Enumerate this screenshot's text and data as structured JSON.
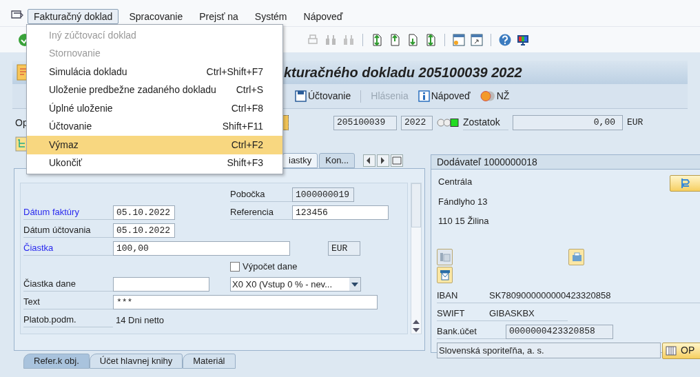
{
  "menu_bar": {
    "items": [
      {
        "label": "Fakturačný doklad",
        "selected": true
      },
      {
        "label": "Spracovanie",
        "selected": false
      },
      {
        "label": "Prejsť na",
        "selected": false
      },
      {
        "label": "Systém",
        "selected": false
      },
      {
        "label": "Nápoveď",
        "selected": false
      }
    ]
  },
  "dropdown_menu": {
    "items": [
      {
        "label": "Iný zúčtovací doklad",
        "disabled": true,
        "selected": false
      },
      {
        "label": "Stornovanie",
        "disabled": true,
        "selected": false
      },
      {
        "label": "Simulácia dokladu",
        "shortcut": "Ctrl+Shift+F7",
        "disabled": false,
        "selected": false
      },
      {
        "label": "Uloženie predbežne zadaného dokladu",
        "shortcut": "Ctrl+S",
        "disabled": false,
        "selected": false
      },
      {
        "label": "Úplné uloženie",
        "shortcut": "Ctrl+F8",
        "disabled": false,
        "selected": false
      },
      {
        "label": "Účtovanie",
        "shortcut": "Shift+F11",
        "disabled": false,
        "selected": false
      },
      {
        "label": "Výmaz",
        "shortcut": "Ctrl+F2",
        "disabled": false,
        "selected": true
      },
      {
        "label": "Ukončiť",
        "shortcut": "Shift+F3",
        "disabled": false,
        "selected": false
      }
    ]
  },
  "title": "kturačného dokladu 205100039 2022",
  "app_toolbar": [
    {
      "kind": "save",
      "label": "Účtovanie",
      "disabled": false
    },
    {
      "kind": "plain",
      "label": "Hlásenia",
      "disabled": true
    },
    {
      "kind": "info",
      "label": "Nápoveď",
      "disabled": false
    },
    {
      "kind": "coins",
      "label": "NŽ",
      "disabled": false
    }
  ],
  "header_row": {
    "label": "Op",
    "document_number": "205100039",
    "year": "2022",
    "balance_label": "Zostatok",
    "balance": "0,00",
    "currency": "EUR"
  },
  "tabs": [
    {
      "label": "iastky",
      "selected": true
    },
    {
      "label": "Kon...",
      "selected": false
    }
  ],
  "form": {
    "branch_label": "Pobočka",
    "branch": "1000000019",
    "invoice_date_label": "Dátum faktúry",
    "invoice_date": "05.10.2022",
    "invoice_date_required": true,
    "reference_label": "Referencia",
    "reference": "123456",
    "posting_date_label": "Dátum účtovania",
    "posting_date": "05.10.2022",
    "posting_date_required": false,
    "amount_label": "Čiastka",
    "amount": "100,00",
    "amount_required": true,
    "currency": "EUR",
    "tax_calc_label": "Výpočet dane",
    "tax_calc_checked": false,
    "tax_amount_label": "Čiastka dane",
    "tax_code": "X0 X0 (Vstup 0 % - nev...",
    "text_label": "Text",
    "text": "***",
    "payment_terms_label": "Platob.podm.",
    "payment_terms": "14 Dni netto"
  },
  "vendor": {
    "title": "Dodávateľ 1000000018",
    "address": [
      "Centrála",
      "Fándlyho 13",
      "110 15 Žilina"
    ],
    "iban_label": "IBAN",
    "iban": "SK7809000000000423320858",
    "swift_label": "SWIFT",
    "swift": "GIBASKBX",
    "bank_account_label": "Bank.účet",
    "bank_account": "0000000423320858",
    "bank_name": "Slovenská sporiteľňa, a. s.",
    "op_button": "OP"
  },
  "bottom_tabs": [
    {
      "label": "Refer.k obj.",
      "selected": true
    },
    {
      "label": "Účet hlavnej knihy",
      "selected": false
    },
    {
      "label": "Materiál",
      "selected": false
    }
  ]
}
